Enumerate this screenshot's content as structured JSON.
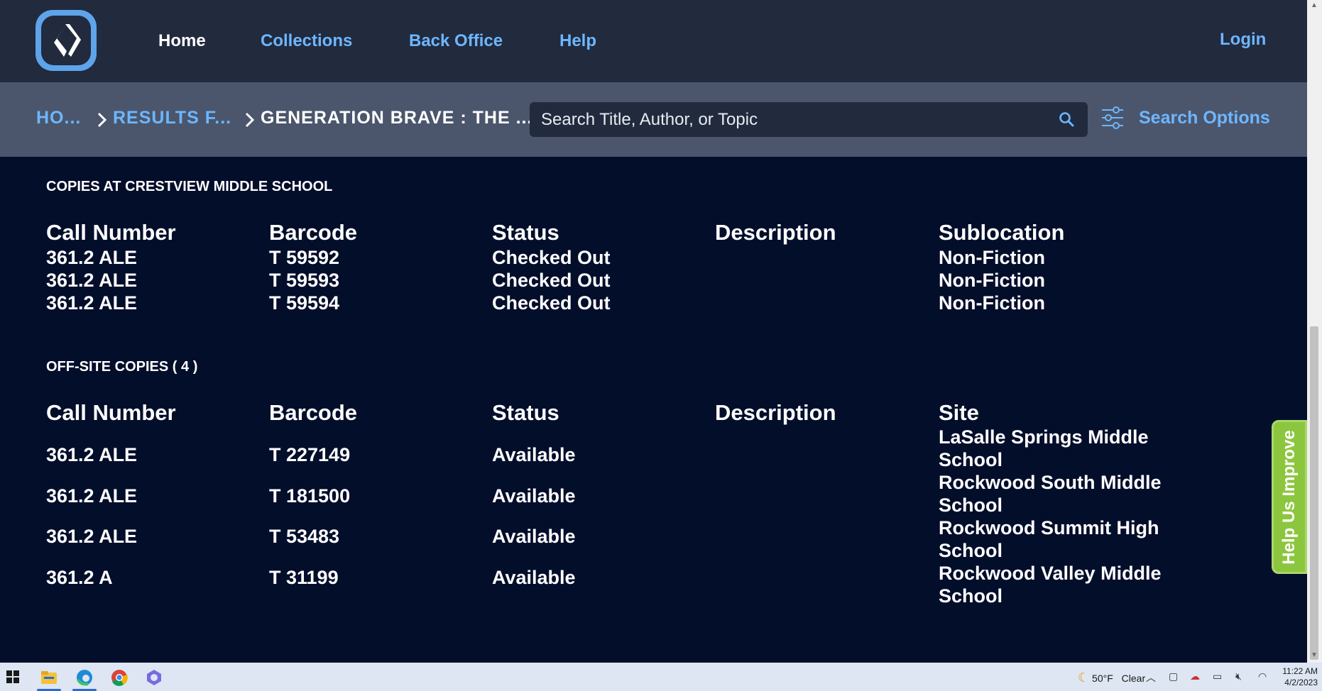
{
  "nav": {
    "links": [
      "Home",
      "Collections",
      "Back Office",
      "Help"
    ],
    "login": "Login"
  },
  "breadcrumb": {
    "items": [
      "HO...",
      "RESULTS F...",
      "GENERATION BRAVE : THE ..."
    ]
  },
  "search": {
    "placeholder": "Search Title, Author, or Topic",
    "options_label": "Search Options"
  },
  "local_copies": {
    "title": "COPIES AT CRESTVIEW MIDDLE SCHOOL",
    "columns": [
      "Call Number",
      "Barcode",
      "Status",
      "Description",
      "Sublocation"
    ],
    "rows": [
      [
        "361.2 ALE",
        "T 59592",
        "Checked Out",
        "",
        "Non-Fiction"
      ],
      [
        "361.2 ALE",
        "T 59593",
        "Checked Out",
        "",
        "Non-Fiction"
      ],
      [
        "361.2 ALE",
        "T 59594",
        "Checked Out",
        "",
        "Non-Fiction"
      ]
    ]
  },
  "offsite_copies": {
    "title": "OFF-SITE COPIES ( 4 )",
    "columns": [
      "Call Number",
      "Barcode",
      "Status",
      "Description",
      "Site"
    ],
    "rows": [
      [
        "361.2 ALE",
        "T 227149",
        "Available",
        "",
        "LaSalle Springs Middle School"
      ],
      [
        "361.2 ALE",
        "T 181500",
        "Available",
        "",
        "Rockwood South Middle School"
      ],
      [
        "361.2 ALE",
        "T 53483",
        "Available",
        "",
        "Rockwood Summit High School"
      ],
      [
        "361.2 A",
        "T 31199",
        "Available",
        "",
        "Rockwood Valley Middle School"
      ]
    ]
  },
  "feedback_tab": "Help Us Improve",
  "taskbar": {
    "weather_temp": "50°F",
    "weather_desc": "Clear",
    "time": "11:22 AM",
    "date": "4/2/2023"
  },
  "colors": {
    "nav_bg": "#222a3e",
    "subbar_bg": "#4b566c",
    "content_bg": "#030e2b",
    "link": "#6eb6ff",
    "feedback": "#8cc63f"
  }
}
